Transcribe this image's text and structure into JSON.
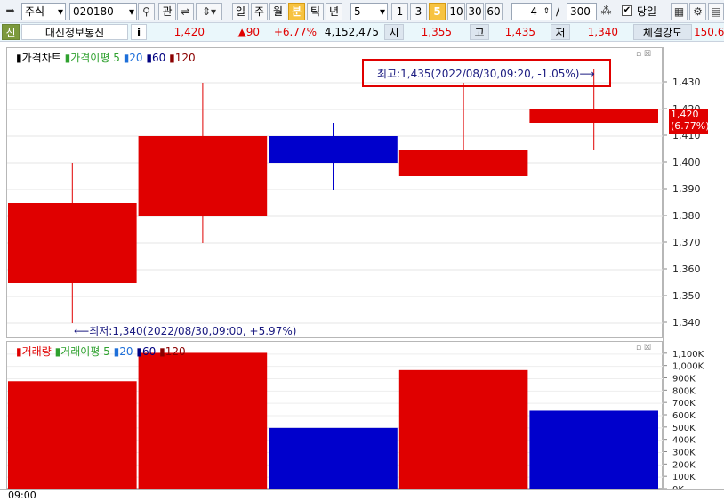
{
  "toolbar": {
    "market": "주식",
    "code": "020180",
    "btn_gwan": "관",
    "periods": [
      "일",
      "주",
      "월",
      "분",
      "틱",
      "년"
    ],
    "selected_period": "분",
    "interval_value": "5",
    "minute_presets": [
      "1",
      "3",
      "5",
      "10",
      "30",
      "60"
    ],
    "selected_preset": "5",
    "count_value": "4",
    "divider": "/",
    "total_value": "300",
    "today_label": "당일",
    "today_checked": true
  },
  "quote": {
    "badge": "신",
    "name": "대신정보통신",
    "info_icon": "i",
    "price": "1,420",
    "change": "▲90",
    "change_pct": "+6.77%",
    "volume": "4,152,475",
    "open_label": "시",
    "open": "1,355",
    "high_label": "고",
    "high": "1,435",
    "low_label": "저",
    "low": "1,340",
    "strength_label": "체결강도",
    "strength": "150.6"
  },
  "price_panel": {
    "title": "가격차트",
    "ma_label": "가격이평",
    "ma_periods": [
      "5",
      "20",
      "60",
      "120"
    ],
    "ma_colors": [
      "#2ea12e",
      "#1e6fd9",
      "#000080",
      "#8b0000"
    ],
    "high_annotation": "최고:1,435(2022/08/30,09:20, -1.05%)⟶",
    "low_annotation": "⟵최저:1,340(2022/08/30,09:00, +5.97%)",
    "current_price_tag": "1,420",
    "current_pct_tag": "(6.77%)"
  },
  "volume_panel": {
    "title": "거래량",
    "ma_label": "거래이평",
    "ma_periods": [
      "5",
      "20",
      "60",
      "120"
    ]
  },
  "x_axis_label": "09:00",
  "colors": {
    "up": "#e00000",
    "down": "#0000cc",
    "annotation_box": "#e00000"
  },
  "chart_data": [
    {
      "type": "candlestick",
      "candles": [
        {
          "open": 1355,
          "high": 1400,
          "low": 1340,
          "close": 1385,
          "direction": "up"
        },
        {
          "open": 1380,
          "high": 1430,
          "low": 1370,
          "close": 1410,
          "direction": "up"
        },
        {
          "open": 1410,
          "high": 1415,
          "low": 1390,
          "close": 1400,
          "direction": "down"
        },
        {
          "open": 1395,
          "high": 1430,
          "low": 1395,
          "close": 1405,
          "direction": "up"
        },
        {
          "open": 1415,
          "high": 1435,
          "low": 1405,
          "close": 1420,
          "direction": "up"
        }
      ],
      "y_ticks": [
        "1,430",
        "1,420",
        "1,410",
        "1,400",
        "1,390",
        "1,380",
        "1,370",
        "1,360",
        "1,350",
        "1,340"
      ],
      "ylim": [
        1334,
        1443
      ]
    },
    {
      "type": "bar",
      "values": [
        880000,
        1110000,
        500000,
        970000,
        640000
      ],
      "directions": [
        "up",
        "up",
        "down",
        "up",
        "down"
      ],
      "y_ticks": [
        "1,100K",
        "1,000K",
        "900K",
        "800K",
        "700K",
        "600K",
        "500K",
        "400K",
        "300K",
        "200K",
        "100K",
        "0K"
      ],
      "ylim": [
        0,
        1200000
      ]
    }
  ]
}
